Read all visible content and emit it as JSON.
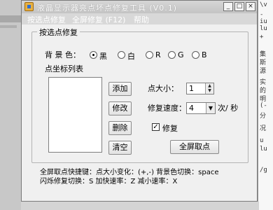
{
  "window": {
    "title": "液晶显示器亮点坏点修复工具 (V0.1)",
    "controls": {
      "minimize": "_",
      "maximize": "□",
      "close": "×"
    }
  },
  "menu": [
    "按选点修复",
    "全屏修复 (F12)",
    "帮助"
  ],
  "group": {
    "title": "按选点修复",
    "bg_label": "背 景 色：",
    "bg_options": [
      "黑",
      "白",
      "R",
      "G",
      "B"
    ],
    "bg_selected": "黑",
    "list_label": "点坐标列表",
    "buttons": {
      "add": "添加",
      "edit": "修改",
      "delete": "删除",
      "clear": "清空"
    },
    "size_label": "点大小：",
    "size_value": "1",
    "speed_label": "修复速度：",
    "speed_value": "4",
    "speed_unit": "次/ 秒",
    "repair_checkbox": "修复",
    "repair_checked": true,
    "fullscreen_button": "全屏取点"
  },
  "footer": {
    "line1": "全屏取点快捷键：点大小变化：(+,-)  背景色切换：space",
    "line2": "闪烁修复切换：S 加快速率：Z 减小速率：X"
  },
  "background_text": {
    "right_fragments": [
      "\\v",
      "-",
      "iu",
      "lu",
      "+",
      "集",
      "斯",
      "源",
      "实",
      "的",
      "明",
      "(-",
      "分",
      "况",
      "u",
      "lu",
      "/g"
    ]
  }
}
